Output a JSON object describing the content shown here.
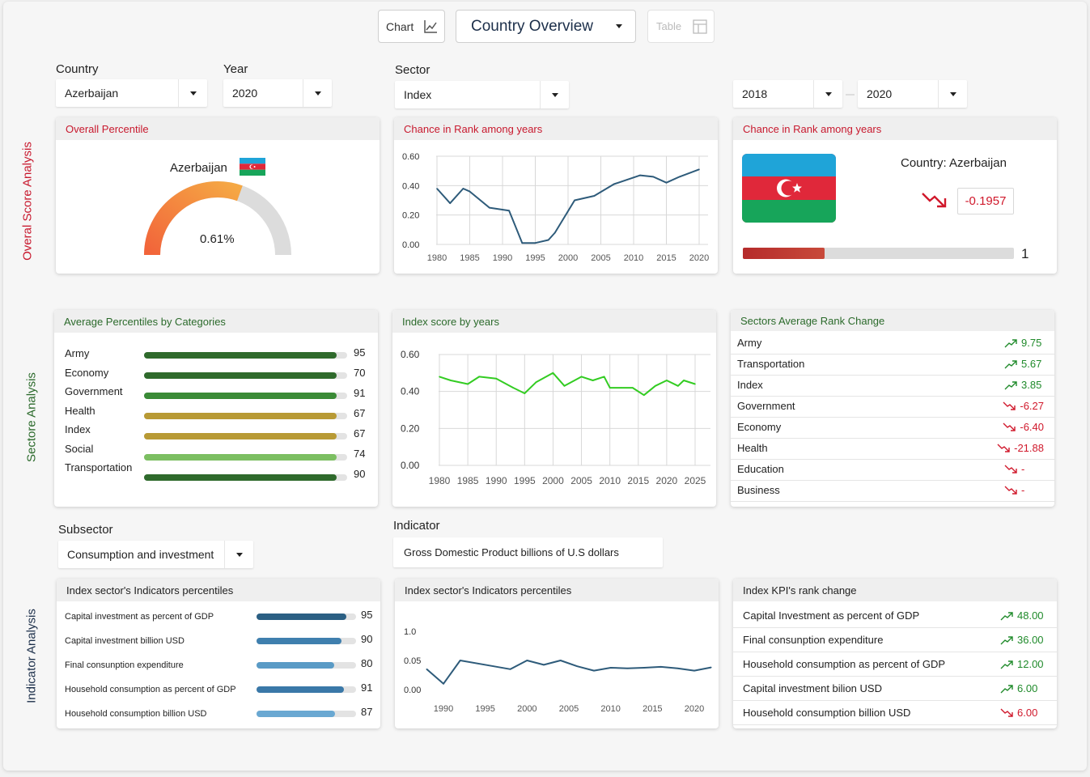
{
  "toolbar": {
    "chart_label": "Chart",
    "view_selected": "Country Overview",
    "table_label": "Table"
  },
  "filters": {
    "country_label": "Country",
    "country_value": "Azerbaijan",
    "year_label": "Year",
    "year_value": "2020",
    "sector_label": "Sector",
    "sector_value": "Index",
    "range_from": "2018",
    "range_to": "2020",
    "subsector_label": "Subsector",
    "subsector_value": "Consumption and investment",
    "indicator_label": "Indicator",
    "indicator_value": "Gross Domestic Product billions of U.S dollars"
  },
  "sections": {
    "overall": "Overal Score Analysis",
    "sector": "Sectore Analysis",
    "indicator": "Indicator Analysis"
  },
  "colors": {
    "overall_label": "#c8192e",
    "sector_label": "#2b6a2b",
    "indicator_label": "#1c2f4a"
  },
  "overall_percentile": {
    "title": "Overall Percentile",
    "country": "Azerbaijan",
    "flag_icon": "azerbaijan-flag-icon",
    "value_text": "0.61%",
    "gauge_fraction": 0.61
  },
  "rank_chart": {
    "title": "Chance in Rank among years",
    "chart_data": {
      "type": "line",
      "x": [
        1980,
        1982,
        1984,
        1985,
        1988,
        1991,
        1993,
        1995,
        1997,
        1998,
        2001,
        2004,
        2007,
        2009,
        2011,
        2013,
        2015,
        2017,
        2020
      ],
      "values": [
        0.38,
        0.28,
        0.38,
        0.36,
        0.25,
        0.23,
        0.01,
        0.01,
        0.03,
        0.08,
        0.3,
        0.33,
        0.41,
        0.44,
        0.47,
        0.46,
        0.42,
        0.46,
        0.51
      ],
      "ylim": [
        0,
        0.6
      ],
      "yticks": [
        "0.60",
        "0.40",
        "0.20",
        "0.00"
      ],
      "xticks": [
        "1980",
        "1985",
        "1990",
        "1995",
        "2000",
        "2005",
        "2010",
        "2015",
        "2020"
      ],
      "color": "#2e5b7a"
    }
  },
  "rank_card": {
    "title": "Chance in Rank among years",
    "country_text": "Country: Azerbaijan",
    "change_value": "-0.1957",
    "trend_icon": "trend-down-icon",
    "rank_value": "1",
    "progress_fraction": 0.3
  },
  "avg_percentiles": {
    "title": "Average Percentiles by Categories",
    "items": [
      {
        "label": "Army",
        "value": "95",
        "fraction": 0.95,
        "color": "#2f6a2c"
      },
      {
        "label": "Economy",
        "value": "70",
        "fraction": 0.95,
        "color": "#2f6a2c"
      },
      {
        "label": "Government",
        "value": "91",
        "fraction": 0.95,
        "color": "#3a8a36"
      },
      {
        "label": "Health",
        "value": "67",
        "fraction": 0.95,
        "color": "#b89a35"
      },
      {
        "label": "Index",
        "value": "67",
        "fraction": 0.95,
        "color": "#b89a35"
      },
      {
        "label": "Social",
        "value": "74",
        "fraction": 0.95,
        "color": "#7cbf62"
      },
      {
        "label": "Transportation",
        "value": "90",
        "fraction": 0.95,
        "color": "#2f6a2c"
      }
    ]
  },
  "index_score": {
    "title": "Index score by years",
    "chart_data": {
      "type": "line",
      "x": [
        1980,
        1982,
        1985,
        1987,
        1990,
        1993,
        1995,
        1997,
        2000,
        2002,
        2005,
        2007,
        2009,
        2010,
        2012,
        2014,
        2016,
        2018,
        2020,
        2022,
        2023,
        2025
      ],
      "values": [
        0.48,
        0.46,
        0.44,
        0.48,
        0.47,
        0.42,
        0.39,
        0.45,
        0.5,
        0.43,
        0.48,
        0.46,
        0.48,
        0.42,
        0.42,
        0.42,
        0.38,
        0.43,
        0.46,
        0.43,
        0.46,
        0.44
      ],
      "ylim": [
        0,
        0.6
      ],
      "yticks": [
        "0.60",
        "0.40",
        "0.20",
        "0.00"
      ],
      "xticks": [
        "1980",
        "1985",
        "1990",
        "1995",
        "2000",
        "2005",
        "2010",
        "2015",
        "2020",
        "2025"
      ],
      "color": "#33cc22"
    }
  },
  "sectors_rank": {
    "title": "Sectors Average Rank Change",
    "items": [
      {
        "label": "Army",
        "value": "9.75",
        "dir": "up"
      },
      {
        "label": "Transportation",
        "value": "5.67",
        "dir": "up"
      },
      {
        "label": "Index",
        "value": "3.85",
        "dir": "up"
      },
      {
        "label": "Government",
        "value": "-6.27",
        "dir": "down"
      },
      {
        "label": "Economy",
        "value": "-6.40",
        "dir": "down"
      },
      {
        "label": "Health",
        "value": "-21.88",
        "dir": "down"
      },
      {
        "label": "Education",
        "value": "-",
        "dir": "down"
      },
      {
        "label": "Business",
        "value": "-",
        "dir": "down"
      }
    ]
  },
  "indicators_bars": {
    "title": "Index sector's Indicators percentiles",
    "items": [
      {
        "label": "Capital investment as percent of GDP",
        "value": "95",
        "fraction": 0.9,
        "color": "#2b5f83"
      },
      {
        "label": "Capital investment billion USD",
        "value": "90",
        "fraction": 0.85,
        "color": "#3f7fae"
      },
      {
        "label": "Final consunption expenditure",
        "value": "80",
        "fraction": 0.78,
        "color": "#5a9bc6"
      },
      {
        "label": "Household consumption as percent of GDP",
        "value": "91",
        "fraction": 0.88,
        "color": "#3a78a8"
      },
      {
        "label": "Household consumption billion USD",
        "value": "87",
        "fraction": 0.79,
        "color": "#6aa8d2"
      }
    ]
  },
  "indicators_line": {
    "title": "Index sector's Indicators percentiles",
    "chart_data": {
      "type": "line",
      "x": [
        1988,
        1990,
        1992,
        1996,
        1998,
        2000,
        2002,
        2004,
        2006,
        2008,
        2010,
        2012,
        2014,
        2016,
        2018,
        2020,
        2022
      ],
      "values": [
        0.07,
        0.02,
        0.1,
        0.08,
        0.07,
        0.1,
        0.085,
        0.1,
        0.08,
        0.065,
        0.075,
        0.073,
        0.075,
        0.078,
        0.073,
        0.065,
        0.076
      ],
      "yticks": [
        "1.0",
        "0.05",
        "0.00"
      ],
      "xticks": [
        "1990",
        "1995",
        "2000",
        "2005",
        "2010",
        "2015",
        "2020"
      ],
      "color": "#2e5b7a"
    }
  },
  "kpi_rank": {
    "title": "Index KPI's rank change",
    "items": [
      {
        "label": "Capital Investment as percent of GDP",
        "value": "48.00",
        "dir": "up"
      },
      {
        "label": "Final consunption expenditure",
        "value": "36.00",
        "dir": "up"
      },
      {
        "label": "Household consumption as percent of GDP",
        "value": "12.00",
        "dir": "up"
      },
      {
        "label": "Capital investment bilion USD",
        "value": "6.00",
        "dir": "up"
      },
      {
        "label": "Household consumption billion USD",
        "value": "6.00",
        "dir": "down"
      }
    ]
  }
}
